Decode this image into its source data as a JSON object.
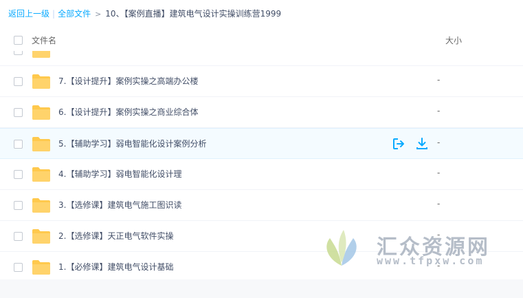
{
  "breadcrumb": {
    "back": "返回上一级",
    "separator": "|",
    "all_files": "全部文件",
    "arrow": ">",
    "current": "10、【案例直播】建筑电气设计实操训练营1999"
  },
  "header": {
    "name_col": "文件名",
    "size_col": "大小"
  },
  "files": [
    {
      "name": "",
      "size": ""
    },
    {
      "name": "7.【设计提升】案例实操之高端办公楼",
      "size": "-"
    },
    {
      "name": "6.【设计提升】案例实操之商业综合体",
      "size": "-"
    },
    {
      "name": "5.【辅助学习】弱电智能化设计案例分析",
      "size": "-"
    },
    {
      "name": "4.【辅助学习】弱电智能化设计理",
      "size": "-"
    },
    {
      "name": "3.【选修课】建筑电气施工图识读",
      "size": "-"
    },
    {
      "name": "2.【选修课】天正电气软件实操",
      "size": "-"
    },
    {
      "name": "1.【必修课】建筑电气设计基础",
      "size": "-"
    }
  ],
  "row_actions": {
    "share_icon": "share-out-icon",
    "download_icon": "download-icon"
  },
  "colors": {
    "accent": "#09aaff",
    "folder": "#ffc94d",
    "hover_row": "#f4fbff"
  },
  "watermark": {
    "title": "汇众资源网",
    "url": "www.tfpxw.com"
  }
}
